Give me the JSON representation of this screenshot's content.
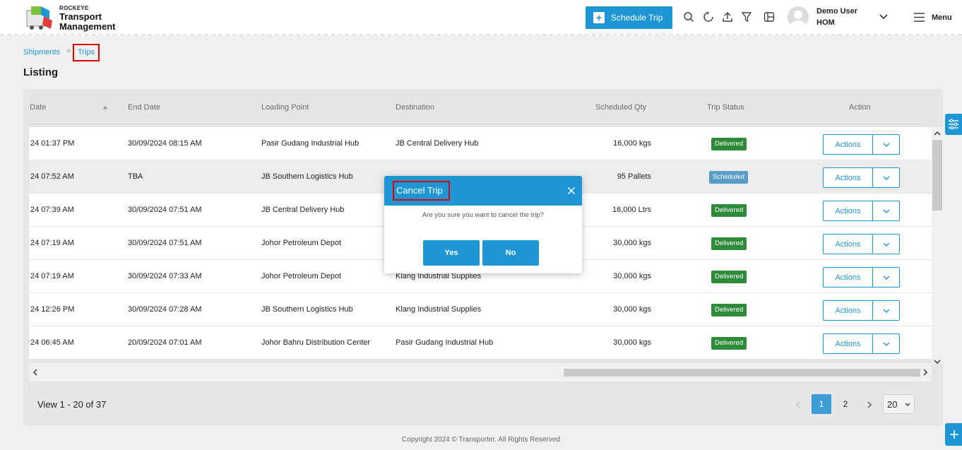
{
  "brand": {
    "small": "ROCKEYE",
    "line1": "Transport",
    "line2": "Management"
  },
  "header": {
    "schedule_label": "Schedule Trip",
    "user_name": "Demo User",
    "user_org": "HOM",
    "menu_label": "Menu"
  },
  "breadcrumb": {
    "item1": "Shipments",
    "separator": "»",
    "item2": "Trips"
  },
  "page_title": "Listing",
  "table": {
    "columns": [
      "e Date",
      "End Date",
      "Loading Point",
      "Destination",
      "Scheduled Qty",
      "Trip Status",
      "Action"
    ],
    "rows": [
      {
        "start": "24 01:37 PM",
        "end": "30/09/2024 08:15 AM",
        "loading": "Pasir Gudang Industrial Hub",
        "dest": "JB Central Delivery Hub",
        "qty": "16,000 kgs",
        "status": "Delivered",
        "action": "Actions"
      },
      {
        "start": "24 07:52 AM",
        "end": "TBA",
        "loading": "JB Southern Logistics Hub",
        "dest": "",
        "qty": "95 Pallets",
        "status": "Scheduled",
        "action": "Actions"
      },
      {
        "start": "24 07:39 AM",
        "end": "30/09/2024 07:51 AM",
        "loading": "JB Central Delivery Hub",
        "dest": "",
        "qty": "16,000 Ltrs",
        "status": "Delivered",
        "action": "Actions"
      },
      {
        "start": "24 07:19 AM",
        "end": "30/09/2024 07:51 AM",
        "loading": "Johor Petroleum Depot",
        "dest": "",
        "qty": "30,000 kgs",
        "status": "Delivered",
        "action": "Actions"
      },
      {
        "start": "24 07:19 AM",
        "end": "30/09/2024 07:33 AM",
        "loading": "Johor Petroleum Depot",
        "dest": "Klang Industrial Supplies",
        "qty": "30,000 kgs",
        "status": "Delivered",
        "action": "Actions"
      },
      {
        "start": "24 12:26 PM",
        "end": "30/09/2024 07:28 AM",
        "loading": "JB Southern Logistics Hub",
        "dest": "Klang Industrial Supplies",
        "qty": "30,000 kgs",
        "status": "Delivered",
        "action": "Actions"
      },
      {
        "start": "24 06:45 AM",
        "end": "20/09/2024 07:01 AM",
        "loading": "Johor Bahru Distribution Center",
        "dest": "Pasir Gudang Industrial Hub",
        "qty": "30,000 kgs",
        "status": "Delivered",
        "action": "Actions"
      }
    ]
  },
  "pagination": {
    "view_text": "View 1 - 20 of 37",
    "pages": [
      "1",
      "2"
    ],
    "active_page": "1",
    "per_page": "20"
  },
  "copyright": "Copyright 2024 © Transporter. All Rights Reserved",
  "modal": {
    "title": "Cancel Trip",
    "message": "Are you sure you want to cancel the trip?",
    "yes_label": "Yes",
    "no_label": "No"
  },
  "colors": {
    "accent": "#1e96d4",
    "delivered": "#2e8b3a",
    "scheduled": "#5a9ec8",
    "highlight": "#dd0000"
  }
}
